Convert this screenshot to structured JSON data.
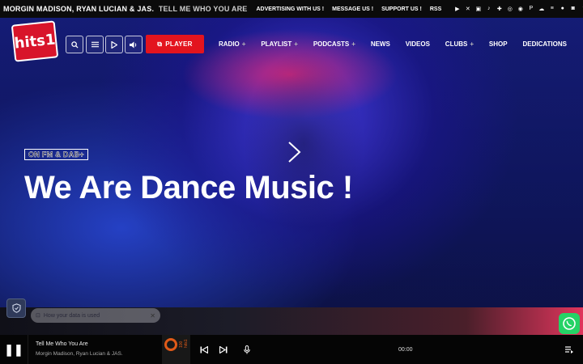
{
  "ticker": {
    "artist": "MORGIN MADISON, RYAN LUCIAN & JAS.",
    "title": "TELL ME WHO YOU ARE"
  },
  "top_links": [
    "ADVERTISING WITH US !",
    "MESSAGE US !",
    "SUPPORT US !",
    "RSS"
  ],
  "social_icons": [
    "youtube-icon",
    "x-icon",
    "twitch-icon",
    "tiktok-icon",
    "vk-icon",
    "instagram-icon",
    "spotify-icon",
    "paypal-icon",
    "soundcloud-icon",
    "deezer-icon",
    "apple-icon",
    "instagram-icon",
    "tumblr-icon",
    "android-icon",
    "power-icon"
  ],
  "header": {
    "logo_text": "hits1",
    "controls": [
      "search-icon",
      "menu-icon",
      "play-icon",
      "volume-icon"
    ],
    "player_label": "PLAYER",
    "nav": [
      {
        "label": "RADIO",
        "has_plus": true
      },
      {
        "label": "PLAYLIST",
        "has_plus": true
      },
      {
        "label": "PODCASTS",
        "has_plus": true
      },
      {
        "label": "NEWS",
        "has_plus": false
      },
      {
        "label": "VIDEOS",
        "has_plus": false
      },
      {
        "label": "CLUBS",
        "has_plus": true
      },
      {
        "label": "SHOP",
        "has_plus": false
      },
      {
        "label": "DEDICATIONS",
        "has_plus": false
      }
    ]
  },
  "hero": {
    "badge": "ON FM & DAB+",
    "headline": "We Are Dance Music !"
  },
  "privacy": {
    "label": "How your data is used"
  },
  "player": {
    "track_title": "Tell Me Who You Are",
    "track_artist": "Morgin Madison, Ryan Lucian & JAS.",
    "time": "00:00",
    "cover_text": "100 hits1"
  },
  "colors": {
    "accent": "#e3141e",
    "whatsapp": "#25d366",
    "hero_blue": "#1a22a0"
  }
}
